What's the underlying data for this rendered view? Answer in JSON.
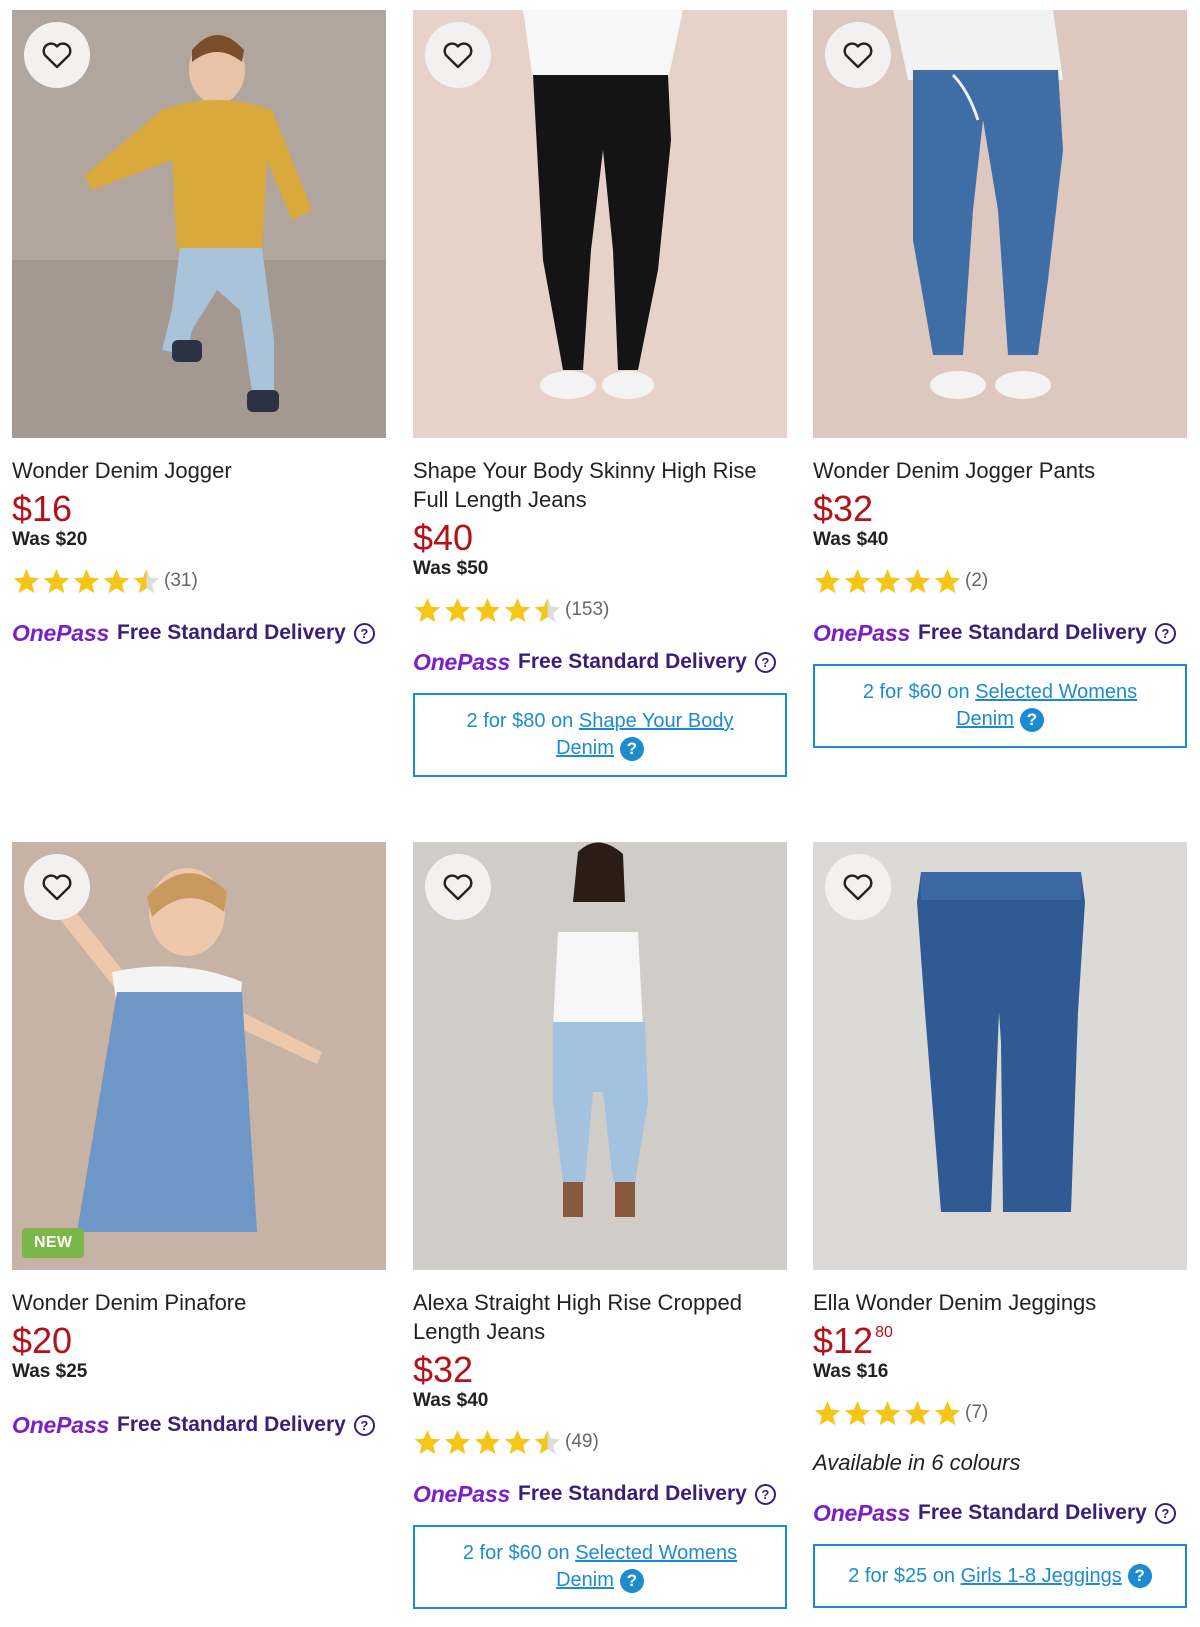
{
  "products": [
    {
      "title": "Wonder Denim Jogger",
      "price": "$16",
      "cents": "",
      "was": "Was $20",
      "rating": 4.5,
      "count": "(31)",
      "onepass_logo": "OnePass",
      "delivery": "Free Standard Delivery",
      "badge": ""
    },
    {
      "title": "Shape Your Body Skinny High Rise Full Length Jeans",
      "price": "$40",
      "cents": "",
      "was": "Was $50",
      "rating": 4.5,
      "count": "(153)",
      "onepass_logo": "OnePass",
      "delivery": "Free Standard Delivery",
      "promo_prefix": "2 for $80 on",
      "promo_link": "Shape Your Body Denim"
    },
    {
      "title": "Wonder Denim Jogger Pants",
      "price": "$32",
      "cents": "",
      "was": "Was $40",
      "rating": 5,
      "count": "(2)",
      "onepass_logo": "OnePass",
      "delivery": "Free Standard Delivery",
      "promo_prefix": "2 for $60 on",
      "promo_link": "Selected Womens Denim"
    },
    {
      "title": "Wonder Denim Pinafore",
      "price": "$20",
      "cents": "",
      "was": "Was $25",
      "onepass_logo": "OnePass",
      "delivery": "Free Standard Delivery",
      "badge": "NEW"
    },
    {
      "title": "Alexa Straight High Rise Cropped Length Jeans",
      "price": "$32",
      "cents": "",
      "was": "Was $40",
      "rating": 4.5,
      "count": "(49)",
      "onepass_logo": "OnePass",
      "delivery": "Free Standard Delivery",
      "promo_prefix": "2 for $60 on",
      "promo_link": "Selected Womens Denim"
    },
    {
      "title": "Ella Wonder Denim Jeggings",
      "price": "$12",
      "cents": "80",
      "was": "Was $16",
      "rating": 5,
      "count": "(7)",
      "available": "Available in 6 colours",
      "onepass_logo": "OnePass",
      "delivery": "Free Standard Delivery",
      "promo_prefix": "2 for $25 on",
      "promo_link": "Girls 1-8 Jeggings"
    }
  ],
  "colors": {
    "price_red": "#b3121a",
    "onepass_purple": "#7a1fc9",
    "delivery_text": "#3a1e7a",
    "promo_blue": "#1c8ccf",
    "star_gold": "#f5c518",
    "new_badge": "#7ab648"
  },
  "icons": {
    "favourite": "heart-outline-icon",
    "info": "question-circle-icon",
    "promo_help": "question-filled-icon",
    "rating": "star-icon"
  }
}
